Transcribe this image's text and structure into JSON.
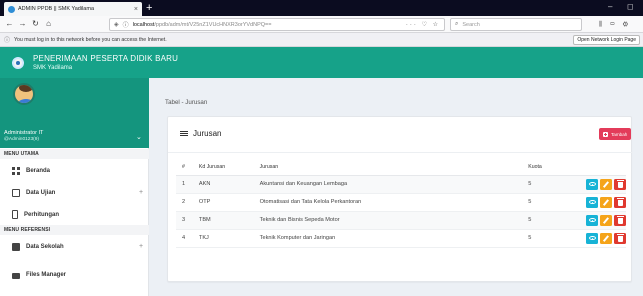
{
  "browser": {
    "tab_title": "ADMIN PPDB || SMK Yadilama",
    "tab_close": "×",
    "new_tab": "+",
    "url_host": "localhost",
    "url_path": "/ppdb/adm/mt/V25nZ1VUcHNXR3orYVdNPQ==",
    "url_actions": "··· ♡ ☆",
    "search_placeholder": "Search",
    "notice_text": "You must log in to this network before you can access the Internet.",
    "notice_button": "Open Network Login Page",
    "window_min": "–",
    "window_max": "◻"
  },
  "app": {
    "title": "PENERIMAAN PESERTA DIDIK BARU",
    "subtitle": "SMK Yadilama",
    "accent": "#16a289",
    "user_name": "Administrator IT",
    "user_id": "@Admin0123(9)"
  },
  "sidebar": {
    "header_main": "MENU UTAMA",
    "header_ref": "MENU REFERENSI",
    "items": [
      {
        "label": "Beranda",
        "icon": "dashboard-icon",
        "expandable": false
      },
      {
        "label": "Data Ujian",
        "icon": "book-icon",
        "expandable": true,
        "plus": "+"
      },
      {
        "label": "Perhitungan",
        "icon": "calculator-icon",
        "expandable": false
      },
      {
        "label": "Data Sekolah",
        "icon": "database-icon",
        "expandable": true,
        "plus": "+"
      },
      {
        "label": "Files Manager",
        "icon": "folder-icon",
        "expandable": false
      }
    ]
  },
  "main": {
    "breadcrumb": "Tabel - Jurusan",
    "card_title": "Jurusan",
    "add_button": "Tambah",
    "columns": [
      "#",
      "Kd Jurusan",
      "Jurusan",
      "Kuota"
    ],
    "rows": [
      {
        "no": "1",
        "kode": "AKN",
        "jurusan": "Akuntansi dan Keuangan Lembaga",
        "kuota": "5"
      },
      {
        "no": "2",
        "kode": "OTP",
        "jurusan": "Otomatisasi dan Tata Kelola Perkantoran",
        "kuota": "5"
      },
      {
        "no": "3",
        "kode": "TBM",
        "jurusan": "Teknik dan Bisnis Sepeda Motor",
        "kuota": "5"
      },
      {
        "no": "4",
        "kode": "TKJ",
        "jurusan": "Teknik Komputer dan Jaringan",
        "kuota": "5"
      }
    ]
  }
}
